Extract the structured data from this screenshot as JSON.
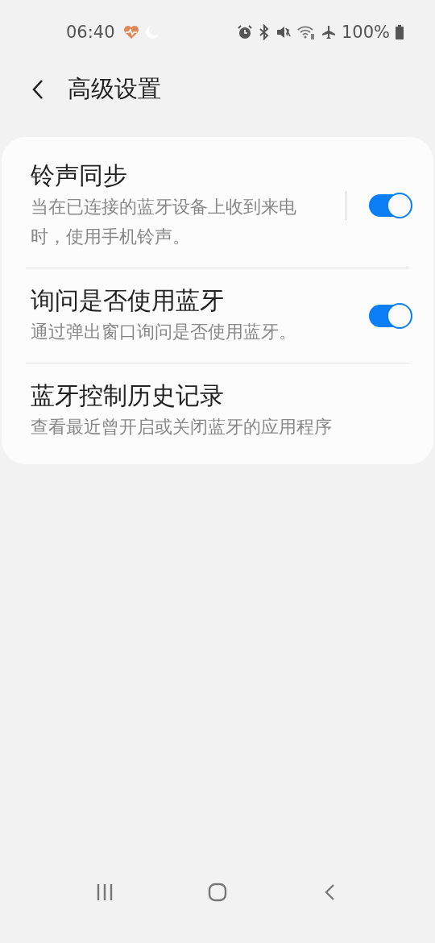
{
  "status_bar": {
    "time": "06:40",
    "battery": "100%"
  },
  "header": {
    "title": "高级设置"
  },
  "items": [
    {
      "kind": "toggle",
      "title": "铃声同步",
      "subtitle": "当在已连接的蓝牙设备上收到来电时，使用手机铃声。",
      "on": true,
      "split": true
    },
    {
      "kind": "toggle",
      "title": "询问是否使用蓝牙",
      "subtitle": "通过弹出窗口询问是否使用蓝牙。",
      "on": true,
      "split": false
    },
    {
      "kind": "link",
      "title": "蓝牙控制历史记录",
      "subtitle": "查看最近曾开启或关闭蓝牙的应用程序"
    }
  ]
}
